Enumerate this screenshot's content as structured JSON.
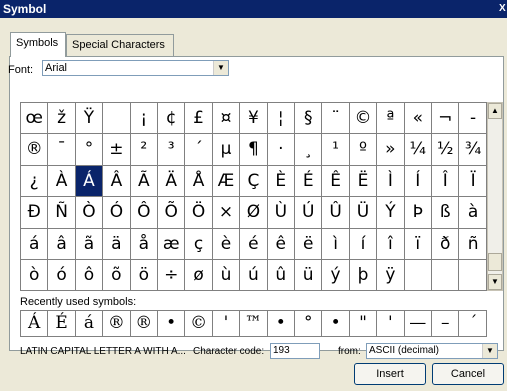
{
  "window": {
    "title": "Symbol",
    "close_glyph": "X"
  },
  "tabs": [
    {
      "label": "Symbols",
      "active": true
    },
    {
      "label": "Special Characters",
      "active": false
    }
  ],
  "font": {
    "label": "Font:",
    "value": "Arial"
  },
  "grid_rows": [
    [
      "œ",
      "ž",
      "Ÿ",
      " ",
      "¡",
      "¢",
      "£",
      "¤",
      "¥",
      "¦",
      "§",
      "¨",
      "©",
      "ª",
      "«",
      "¬",
      "-"
    ],
    [
      "®",
      "¯",
      "°",
      "±",
      "²",
      "³",
      "´",
      "µ",
      "¶",
      "·",
      "¸",
      "¹",
      "º",
      "»",
      "¼",
      "½",
      "¾"
    ],
    [
      "¿",
      "À",
      "Á",
      "Â",
      "Ã",
      "Ä",
      "Å",
      "Æ",
      "Ç",
      "È",
      "É",
      "Ê",
      "Ë",
      "Ì",
      "Í",
      "Î",
      "Ï"
    ],
    [
      "Ð",
      "Ñ",
      "Ò",
      "Ó",
      "Ô",
      "Õ",
      "Ö",
      "×",
      "Ø",
      "Ù",
      "Ú",
      "Û",
      "Ü",
      "Ý",
      "Þ",
      "ß",
      "à"
    ],
    [
      "á",
      "â",
      "ã",
      "ä",
      "å",
      "æ",
      "ç",
      "è",
      "é",
      "ê",
      "ë",
      "ì",
      "í",
      "î",
      "ï",
      "ð",
      "ñ"
    ],
    [
      "ò",
      "ó",
      "ô",
      "õ",
      "ö",
      "÷",
      "ø",
      "ù",
      "ú",
      "û",
      "ü",
      "ý",
      "þ",
      "ÿ",
      "",
      "",
      ""
    ]
  ],
  "selected_symbol": "Á",
  "recent": {
    "label": "Recently used symbols:",
    "items": [
      "Á",
      "É",
      "á",
      "®",
      "®",
      "•",
      "©",
      "'",
      "™",
      "•",
      "°",
      "•",
      "\"",
      "'",
      "—",
      "–",
      "´"
    ]
  },
  "status": {
    "description": "LATIN CAPITAL LETTER A WITH A...",
    "code_label": "Character code:",
    "code_value": "193",
    "from_label": "from:",
    "from_value": "ASCII (decimal)"
  },
  "buttons": {
    "insert": "Insert",
    "cancel": "Cancel"
  }
}
